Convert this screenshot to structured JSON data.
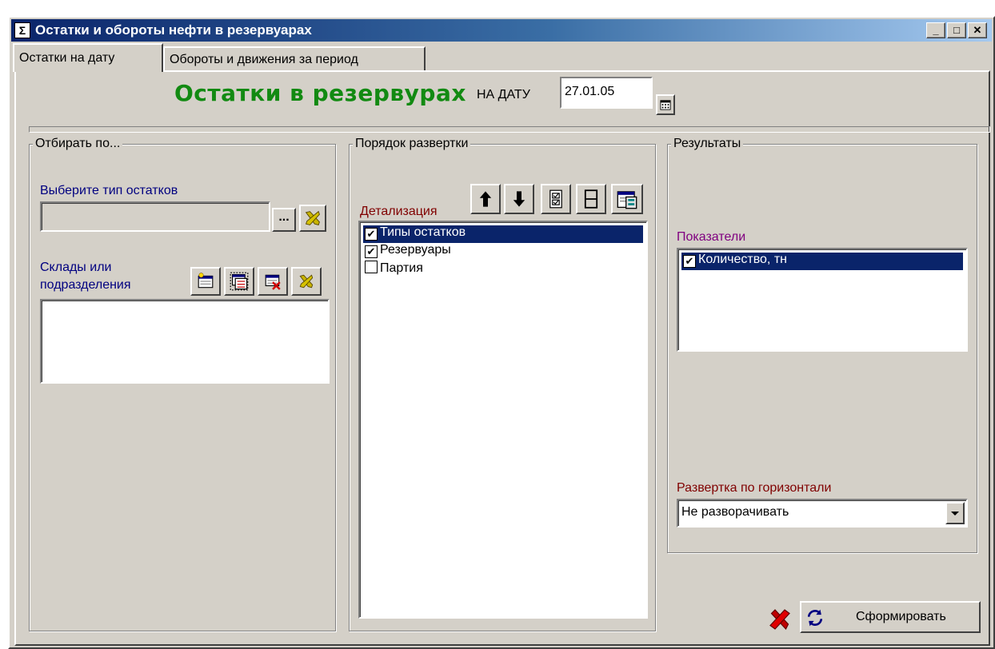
{
  "window": {
    "title": "Остатки и обороты нефти в резервуарах",
    "controls": {
      "minimize": "_",
      "maximize": "□",
      "close": "✕"
    }
  },
  "tabs": [
    {
      "label": "Остатки на дату",
      "active": true
    },
    {
      "label": "Обороты и движения за период",
      "active": false
    }
  ],
  "header": {
    "title": "Остатки в резервурах",
    "date_label": "НА ДАТУ",
    "date_value": "27.01.05"
  },
  "filter_group": {
    "title": "Отбирать по...",
    "type_label": "Выберите тип остатков",
    "type_value": "",
    "browse_label": "...",
    "warehouses_label_line1": "Склады или",
    "warehouses_label_line2": "подразделения"
  },
  "order_group": {
    "title": "Порядок развертки",
    "detail_label": "Детализация",
    "items": [
      {
        "label": "Типы остатков",
        "checked": true,
        "selected": true
      },
      {
        "label": "Резервуары",
        "checked": true,
        "selected": false
      },
      {
        "label": "Партия",
        "checked": false,
        "selected": false
      }
    ]
  },
  "results_group": {
    "title": "Результаты",
    "indicators_label": "Показатели",
    "indicators": [
      {
        "label": "Количество, тн",
        "checked": true,
        "selected": true
      }
    ],
    "horizontal_label": "Развертка по горизонтали",
    "horizontal_value": "Не разворачивать"
  },
  "actions": {
    "generate_label": "Сформировать"
  },
  "colors": {
    "title_green": "#128a12",
    "selection": "#0a246a",
    "label_blue": "#000080",
    "label_red": "#800000",
    "label_purple": "#800080"
  }
}
